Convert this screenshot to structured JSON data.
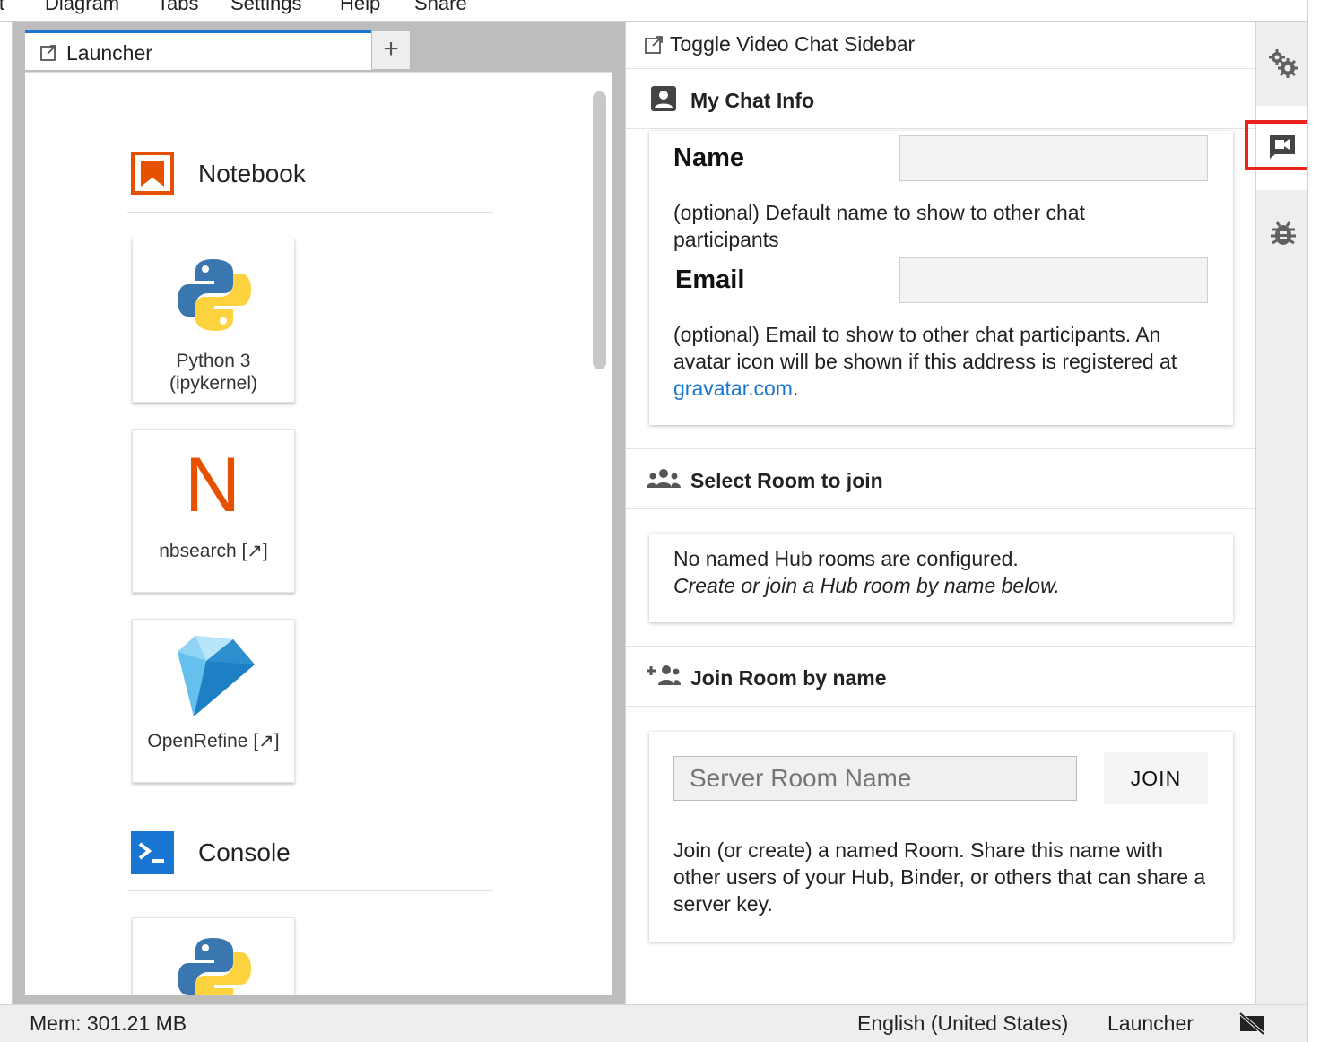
{
  "menubar": {
    "items": [
      "it",
      "Diagram",
      "Tabs",
      "Settings",
      "Help",
      "Share"
    ]
  },
  "tabs": {
    "launcher_label": "Launcher",
    "add_label": "+"
  },
  "launcher": {
    "notebook_section": "Notebook",
    "console_section": "Console",
    "cards": [
      {
        "label_line1": "Python 3",
        "label_line2": "(ipykernel)",
        "icon": "python-logo"
      },
      {
        "label_line1": "nbsearch [↗]",
        "icon": "nbsearch-n-logo",
        "glyph": "N"
      },
      {
        "label_line1": "OpenRefine [↗]",
        "icon": "openrefine-diamond-logo"
      },
      {
        "icon": "python-logo"
      }
    ]
  },
  "chat": {
    "title": "Toggle Video Chat Sidebar",
    "my_info_header": "My Chat Info",
    "name_label": "Name",
    "name_value": "",
    "name_help": "(optional) Default name to show to other chat participants",
    "email_label": "Email",
    "email_value": "",
    "email_help_prefix": "(optional) Email to show to other chat participants. An avatar icon will be shown if this address is registered at ",
    "email_help_link": "gravatar.com",
    "email_help_suffix": ".",
    "select_room_header": "Select Room to join",
    "no_rooms_line1": "No named Hub rooms are configured.",
    "no_rooms_line2": "Create or join a Hub room by name below.",
    "join_room_header": "Join Room by name",
    "room_input_placeholder": "Server Room Name",
    "join_button": "JOIN",
    "join_help": "Join (or create) a named Room. Share this name with other users of your Hub, Binder, or others that can share a server key."
  },
  "right_sidebar": {
    "items": [
      "gears-icon",
      "video-chat-icon",
      "bug-icon"
    ],
    "highlight_color": "#e8231a"
  },
  "status": {
    "memory": "Mem: 301.21 MB",
    "language": "English (United States)",
    "current": "Launcher",
    "camera_icon": "video-off-icon"
  },
  "colors": {
    "accent": "#1976d2",
    "notebook_orange": "#e65100",
    "console_blue": "#1976d2"
  }
}
